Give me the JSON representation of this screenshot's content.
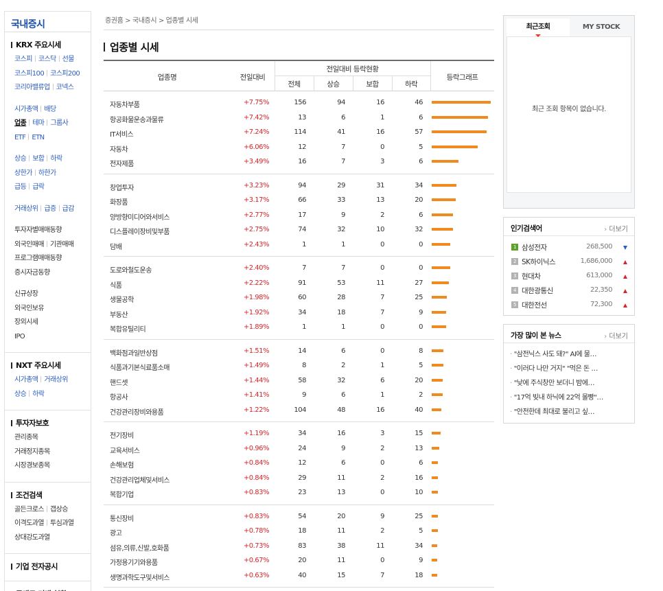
{
  "sidebar": {
    "title": "국내증시",
    "sections": [
      {
        "title": "KRX 주요시세",
        "groups": [
          {
            "blue": true,
            "lines": [
              [
                "코스피",
                "코스닥",
                "선물"
              ],
              [
                "코스피100",
                "코스피200"
              ],
              [
                "코리아밸류업",
                "코넥스"
              ]
            ]
          },
          {
            "blue": true,
            "lines": [
              [
                "시가총액",
                "배당"
              ],
              [
                "업종",
                "테마",
                "그룹사"
              ],
              [
                "ETF",
                "ETN"
              ]
            ]
          },
          {
            "blue": true,
            "lines": [
              [
                "상승",
                "보합",
                "하락"
              ],
              [
                "상한가",
                "하한가"
              ],
              [
                "급등",
                "급락"
              ]
            ]
          },
          {
            "blue": true,
            "lines": [
              [
                "거래상위",
                "급증",
                "급감"
              ]
            ]
          },
          {
            "blue": false,
            "lines": [
              [
                "투자자별매매동향"
              ],
              [
                "외국인매매",
                "기관매매"
              ],
              [
                "프로그램매매동향"
              ],
              [
                "증시자금동향"
              ]
            ]
          },
          {
            "blue": false,
            "lines": [
              [
                "신규상장"
              ],
              [
                "외국인보유"
              ],
              [
                "장외시세"
              ],
              [
                "IPO"
              ]
            ]
          }
        ]
      },
      {
        "title": "NXT 주요시세",
        "groups": [
          {
            "blue": true,
            "lines": [
              [
                "시가총액",
                "거래상위"
              ],
              [
                "상승",
                "하락"
              ]
            ]
          }
        ]
      },
      {
        "title": "투자자보호",
        "groups": [
          {
            "blue": false,
            "lines": [
              [
                "관리종목"
              ],
              [
                "거래정지종목"
              ],
              [
                "시장경보종목"
              ]
            ]
          }
        ]
      },
      {
        "title": "조건검색",
        "groups": [
          {
            "blue": false,
            "lines": [
              [
                "골든크로스",
                "갭상승"
              ],
              [
                "이격도과열",
                "투심과열"
              ],
              [
                "상대강도과열"
              ]
            ]
          }
        ]
      },
      {
        "title": "기업 전자공시",
        "groups": []
      },
      {
        "title": "공매도 거래 현황",
        "groups": []
      }
    ]
  },
  "breadcrumb": "증권홈 > 국내증시 > 업종별 시세",
  "page_title": "업종별 시세",
  "table": {
    "headers": {
      "name": "업종명",
      "change": "전일대비",
      "group": "전일대비 등락현황",
      "total": "전체",
      "up": "상승",
      "flat": "보합",
      "down": "하락",
      "graph": "등락그래프"
    },
    "groups": [
      [
        {
          "name": "자동차부품",
          "change": "+7.75%",
          "total": "156",
          "up": "94",
          "flat": "16",
          "down": "46",
          "pct": 7.75
        },
        {
          "name": "항공화물운송과물류",
          "change": "+7.42%",
          "total": "13",
          "up": "6",
          "flat": "1",
          "down": "6",
          "pct": 7.42
        },
        {
          "name": "IT서비스",
          "change": "+7.24%",
          "total": "114",
          "up": "41",
          "flat": "16",
          "down": "57",
          "pct": 7.24
        },
        {
          "name": "자동차",
          "change": "+6.06%",
          "total": "12",
          "up": "7",
          "flat": "0",
          "down": "5",
          "pct": 6.06
        },
        {
          "name": "전자제품",
          "change": "+3.49%",
          "total": "16",
          "up": "7",
          "flat": "3",
          "down": "6",
          "pct": 3.49
        }
      ],
      [
        {
          "name": "창업투자",
          "change": "+3.23%",
          "total": "94",
          "up": "29",
          "flat": "31",
          "down": "34",
          "pct": 3.23
        },
        {
          "name": "화장품",
          "change": "+3.17%",
          "total": "66",
          "up": "33",
          "flat": "13",
          "down": "20",
          "pct": 3.17
        },
        {
          "name": "양방향미디어와서비스",
          "change": "+2.77%",
          "total": "17",
          "up": "9",
          "flat": "2",
          "down": "6",
          "pct": 2.77
        },
        {
          "name": "디스플레이장비및부품",
          "change": "+2.75%",
          "total": "74",
          "up": "32",
          "flat": "10",
          "down": "32",
          "pct": 2.75
        },
        {
          "name": "담배",
          "change": "+2.43%",
          "total": "1",
          "up": "1",
          "flat": "0",
          "down": "0",
          "pct": 2.43
        }
      ],
      [
        {
          "name": "도로와철도운송",
          "change": "+2.40%",
          "total": "7",
          "up": "7",
          "flat": "0",
          "down": "0",
          "pct": 2.4
        },
        {
          "name": "식품",
          "change": "+2.22%",
          "total": "91",
          "up": "53",
          "flat": "11",
          "down": "27",
          "pct": 2.22
        },
        {
          "name": "생물공학",
          "change": "+1.98%",
          "total": "60",
          "up": "28",
          "flat": "7",
          "down": "25",
          "pct": 1.98
        },
        {
          "name": "부동산",
          "change": "+1.92%",
          "total": "34",
          "up": "18",
          "flat": "7",
          "down": "9",
          "pct": 1.92
        },
        {
          "name": "복합유틸리티",
          "change": "+1.89%",
          "total": "1",
          "up": "1",
          "flat": "0",
          "down": "0",
          "pct": 1.89
        }
      ],
      [
        {
          "name": "백화점과일반상점",
          "change": "+1.51%",
          "total": "14",
          "up": "6",
          "flat": "0",
          "down": "8",
          "pct": 1.51
        },
        {
          "name": "식품과기본식료품소매",
          "change": "+1.49%",
          "total": "8",
          "up": "2",
          "flat": "1",
          "down": "5",
          "pct": 1.49
        },
        {
          "name": "핸드셋",
          "change": "+1.44%",
          "total": "58",
          "up": "32",
          "flat": "6",
          "down": "20",
          "pct": 1.44
        },
        {
          "name": "항공사",
          "change": "+1.41%",
          "total": "9",
          "up": "6",
          "flat": "1",
          "down": "2",
          "pct": 1.41
        },
        {
          "name": "건강관리장비와용품",
          "change": "+1.22%",
          "total": "104",
          "up": "48",
          "flat": "16",
          "down": "40",
          "pct": 1.22
        }
      ],
      [
        {
          "name": "전기장비",
          "change": "+1.19%",
          "total": "34",
          "up": "16",
          "flat": "3",
          "down": "15",
          "pct": 1.19
        },
        {
          "name": "교육서비스",
          "change": "+0.96%",
          "total": "24",
          "up": "9",
          "flat": "2",
          "down": "13",
          "pct": 0.96
        },
        {
          "name": "손해보험",
          "change": "+0.84%",
          "total": "12",
          "up": "6",
          "flat": "0",
          "down": "6",
          "pct": 0.84
        },
        {
          "name": "건강관리업체및서비스",
          "change": "+0.84%",
          "total": "29",
          "up": "11",
          "flat": "2",
          "down": "16",
          "pct": 0.84
        },
        {
          "name": "복합기업",
          "change": "+0.83%",
          "total": "23",
          "up": "13",
          "flat": "0",
          "down": "10",
          "pct": 0.83
        }
      ],
      [
        {
          "name": "통신장비",
          "change": "+0.83%",
          "total": "54",
          "up": "20",
          "flat": "9",
          "down": "25",
          "pct": 0.83
        },
        {
          "name": "광고",
          "change": "+0.78%",
          "total": "18",
          "up": "11",
          "flat": "2",
          "down": "5",
          "pct": 0.78
        },
        {
          "name": "섬유,의류,신발,호화품",
          "change": "+0.73%",
          "total": "83",
          "up": "38",
          "flat": "11",
          "down": "34",
          "pct": 0.73
        },
        {
          "name": "가정용기기와용품",
          "change": "+0.67%",
          "total": "20",
          "up": "11",
          "flat": "0",
          "down": "9",
          "pct": 0.67
        },
        {
          "name": "생명과학도구및서비스",
          "change": "+0.63%",
          "total": "40",
          "up": "15",
          "flat": "7",
          "down": "18",
          "pct": 0.63
        }
      ]
    ]
  },
  "recent": {
    "tab_active": "최근조회",
    "tab_other": "MY STOCK",
    "empty": "최근 조회 항목이 없습니다."
  },
  "popular": {
    "title": "인기검색어",
    "more": "더보기",
    "items": [
      {
        "rank": "1",
        "name": "삼성전자",
        "price": "268,500",
        "dir": "down"
      },
      {
        "rank": "2",
        "name": "SK하이닉스",
        "price": "1,686,000",
        "dir": "up"
      },
      {
        "rank": "3",
        "name": "현대차",
        "price": "613,000",
        "dir": "up"
      },
      {
        "rank": "4",
        "name": "대한광통신",
        "price": "22,350",
        "dir": "up"
      },
      {
        "rank": "5",
        "name": "대한전선",
        "price": "72,300",
        "dir": "up"
      }
    ]
  },
  "news": {
    "title": "가장 많이 본 뉴스",
    "more": "더보기",
    "items": [
      "\"삼전닉스 사도 돼?\" AI에 물…",
      "\"이러다 나만 거지\" \"먹은 돈 …",
      "\"낮에 주식창만 보더니 밤에…",
      "\"17억 빚내 하닉에 22억 몰빵\"…",
      "\"안전한데 최대로 불리고 싶…"
    ]
  },
  "colors": {
    "accent_blue": "#1b4fa8",
    "rise_red": "#d6262b",
    "bar_orange": "#f08a1e"
  }
}
